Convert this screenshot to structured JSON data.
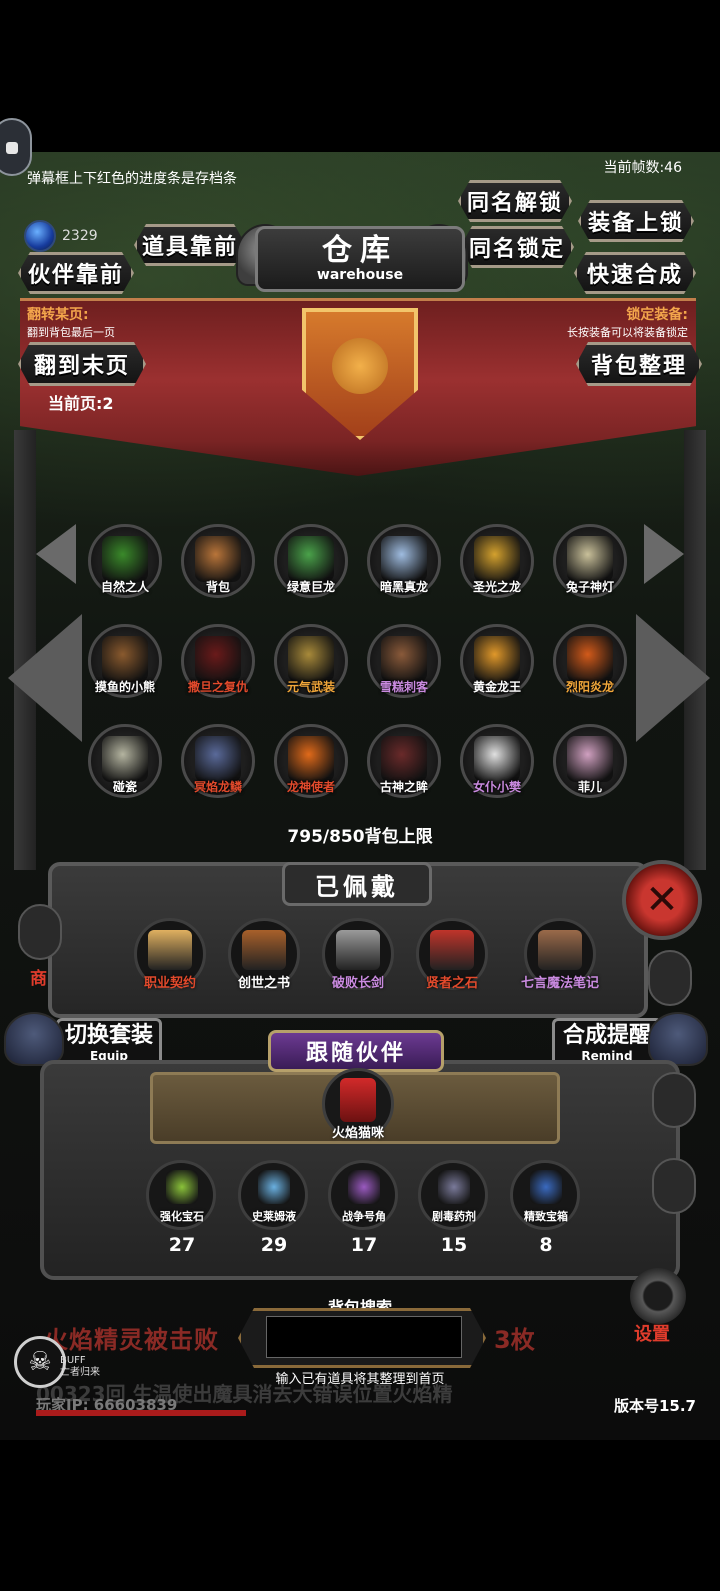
{
  "hud": {
    "tip": "弹幕框上下红色的进度条是存档条",
    "fps": "当前帧数:46",
    "gem_count": "2329"
  },
  "buttons": {
    "same_name_unlock": "同名解锁",
    "equip_lock": "装备上锁",
    "items_front": "道具靠前",
    "same_name_lock": "同名锁定",
    "partners_front": "伙伴靠前",
    "quick_merge": "快速合成",
    "to_last_page": "翻到末页",
    "bag_sort": "背包整理"
  },
  "warehouse": {
    "title_cn": "仓库",
    "title_en": "warehouse",
    "flip_label": "翻转某页:",
    "flip_sub": "翻到背包最后一页",
    "lock_label": "锁定装备:",
    "lock_sub": "长按装备可以将装备锁定",
    "current_page": "当前页:2",
    "capacity": "795/850背包上限"
  },
  "items": [
    {
      "name": "自然之人",
      "color": "#ffffff",
      "art": "#3a8a2a"
    },
    {
      "name": "背包",
      "color": "#ffffff",
      "art": "#b9753a"
    },
    {
      "name": "绿意巨龙",
      "color": "#ffffff",
      "art": "#4aa24a"
    },
    {
      "name": "暗黑真龙",
      "color": "#ffffff",
      "art": "#9fbce0"
    },
    {
      "name": "圣光之龙",
      "color": "#ffffff",
      "art": "#d4a12e"
    },
    {
      "name": "兔子神灯",
      "color": "#ffffff",
      "art": "#c9c09a"
    },
    {
      "name": "摸鱼的小熊",
      "color": "#ffffff",
      "art": "#8a5a2e"
    },
    {
      "name": "撒旦之复仇",
      "color": "#e24a2c",
      "art": "#6a1a1a"
    },
    {
      "name": "元气武装",
      "color": "#f2a73a",
      "art": "#a88a3a"
    },
    {
      "name": "雪糕刺客",
      "color": "#c98adf",
      "art": "#8a5a3a"
    },
    {
      "name": "黄金龙王",
      "color": "#ffffff",
      "art": "#e0982a"
    },
    {
      "name": "烈阳炎龙",
      "color": "#f2a73a",
      "art": "#d25a1a"
    },
    {
      "name": "碰瓷",
      "color": "#ffffff",
      "art": "#b4b4a0"
    },
    {
      "name": "冥焰龙鳞",
      "color": "#e24a2c",
      "art": "#5a6a9a"
    },
    {
      "name": "龙神使者",
      "color": "#e24a2c",
      "art": "#e06a1a"
    },
    {
      "name": "古神之眸",
      "color": "#ffffff",
      "art": "#6a2a2a"
    },
    {
      "name": "女仆小樊",
      "color": "#c98adf",
      "art": "#e0e0e0"
    },
    {
      "name": "菲儿",
      "color": "#ffffff",
      "art": "#d0a0c0"
    }
  ],
  "equipped": {
    "title": "已佩戴",
    "items": [
      {
        "name": "职业契约",
        "color": "#e24a2c",
        "art": "#e0b060"
      },
      {
        "name": "创世之书",
        "color": "#ffffff",
        "art": "#a8602a"
      },
      {
        "name": "破败长剑",
        "color": "#c98adf",
        "art": "#9a9a9a"
      },
      {
        "name": "贤者之石",
        "color": "#e24a2c",
        "art": "#c0342a"
      },
      {
        "name": "七言魔法笔记",
        "color": "#c98adf",
        "art": "#9a6a4a"
      }
    ]
  },
  "side": {
    "shop": "商"
  },
  "swap": {
    "equip_cn": "切换套装",
    "equip_en": "Equip",
    "remind_cn": "合成提醒",
    "remind_en": "Remind"
  },
  "follow": {
    "title": "跟随伙伴",
    "pet_name": "火焰猫咪"
  },
  "consumables": [
    {
      "name": "强化宝石",
      "qty": "27",
      "art": "#8ac23a"
    },
    {
      "name": "史莱姆液",
      "qty": "29",
      "art": "#6ab0e0"
    },
    {
      "name": "战争号角",
      "qty": "17",
      "art": "#9a5ac0"
    },
    {
      "name": "剧毒药剂",
      "qty": "15",
      "art": "#7a7a9a"
    },
    {
      "name": "精致宝箱",
      "qty": "8",
      "art": "#3a6ac0"
    }
  ],
  "footer": {
    "settings": "设置",
    "ticker_left": "火焰精灵被击败",
    "ticker_right": "3枚",
    "ticker2": "00323回 生温使出魔具消去大错误位置火焰精",
    "search_title": "背包搜索",
    "search_placeholder": "",
    "search_hint": "输入已有道具将其整理到首页",
    "buff_top": "BUFF",
    "buff_sub": "亡者归来",
    "ip": "玩家IP: 66603839",
    "version": "版本号15.7"
  }
}
